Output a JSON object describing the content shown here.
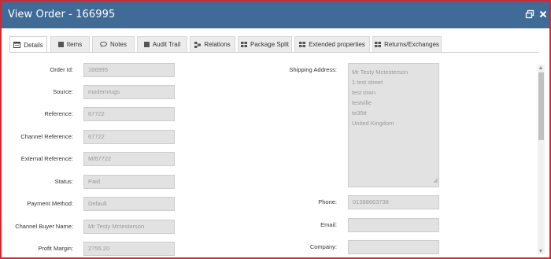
{
  "window": {
    "title": "View Order - 166995",
    "colors": {
      "titlebar": "#3f6b96",
      "border": "#d9262e"
    },
    "buttons": [
      "restore-icon",
      "close-icon"
    ]
  },
  "tabs": [
    {
      "label": "Details",
      "icon": "details-icon",
      "active": true
    },
    {
      "label": "Items",
      "icon": "items-icon",
      "active": false
    },
    {
      "label": "Notes",
      "icon": "notes-icon",
      "active": false
    },
    {
      "label": "Audit Trail",
      "icon": "audit-trail-icon",
      "active": false
    },
    {
      "label": "Relations",
      "icon": "relations-icon",
      "active": false
    },
    {
      "label": "Package Split",
      "icon": "package-split-icon",
      "active": false
    },
    {
      "label": "Extended properties",
      "icon": "extended-properties-icon",
      "active": false
    },
    {
      "label": "Returns/Exchanges",
      "icon": "returns-exchanges-icon",
      "active": false
    }
  ],
  "left_fields": [
    {
      "label": "Order Id:",
      "value": "166995"
    },
    {
      "label": "Source:",
      "value": "modernrugs"
    },
    {
      "label": "Reference:",
      "value": "67722"
    },
    {
      "label": "Channel Reference:",
      "value": "67722"
    },
    {
      "label": "External Reference:",
      "value": "M/67722"
    },
    {
      "label": "Status:",
      "value": "Paid"
    },
    {
      "label": "Payment Method:",
      "value": "Default"
    },
    {
      "label": "Channel Buyer Name:",
      "value": "Mr Testy Mctesterson"
    },
    {
      "label": "Profit Margin:",
      "value": "2755.20"
    }
  ],
  "shipping": {
    "label": "Shipping Address:",
    "lines": [
      "Mr Testy Mctesterson",
      "1 test street",
      "test town",
      "testville",
      "te35tt",
      "United Kingdom"
    ]
  },
  "right_fields": [
    {
      "label": "Phone:",
      "value": "01388663738"
    },
    {
      "label": "Email:",
      "value": ""
    },
    {
      "label": "Company:",
      "value": ""
    }
  ]
}
